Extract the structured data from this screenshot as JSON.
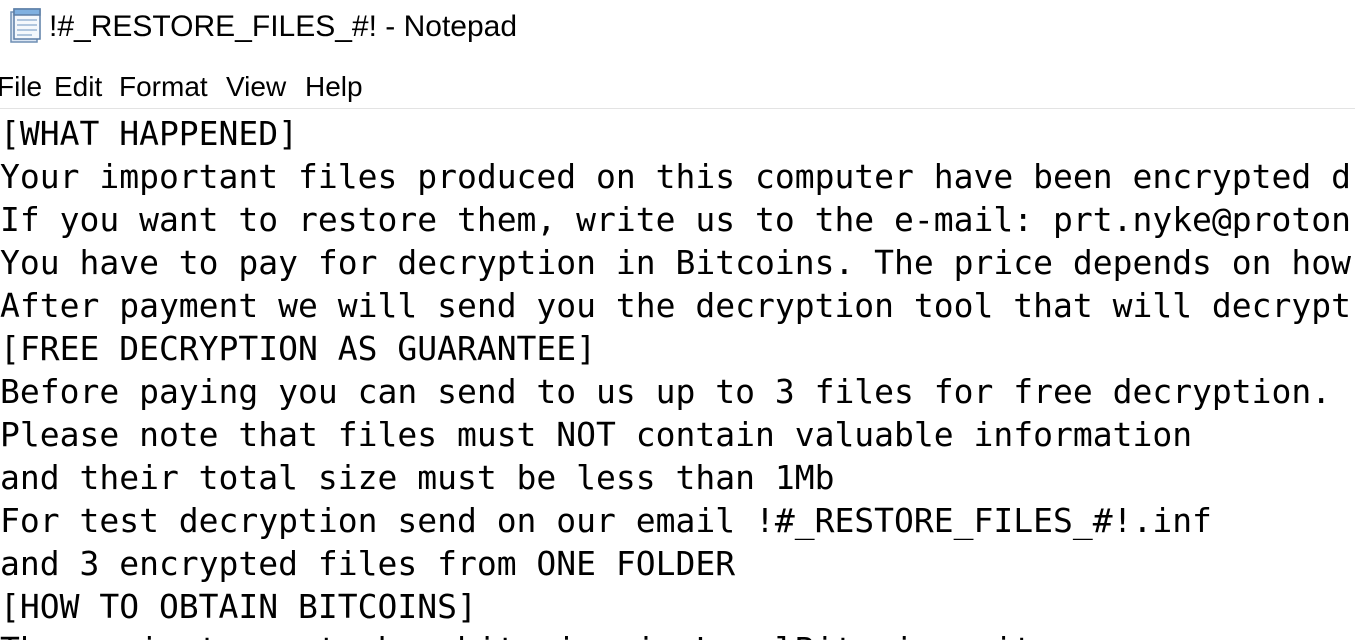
{
  "window": {
    "title": "!#_RESTORE_FILES_#! - Notepad",
    "icon": "notepad-icon"
  },
  "menu": {
    "items": [
      "File",
      "Edit",
      "Format",
      "View",
      "Help"
    ]
  },
  "document": {
    "lines": [
      "[WHAT HAPPENED]",
      "Your important files produced on this computer have been encrypted d",
      "If you want to restore them, write us to the e-mail: prt.nyke@proton",
      "You have to pay for decryption in Bitcoins. The price depends on how",
      "After payment we will send you the decryption tool that will decrypt",
      "[FREE DECRYPTION AS GUARANTEE]",
      "Before paying you can send to us up to 3 files for free decryption.",
      "Please note that files must NOT contain valuable information",
      "and their total size must be less than 1Mb",
      "For test decryption send on our email !#_RESTORE_FILES_#!.inf",
      "and 3 encrypted files from ONE FOLDER",
      "[HOW TO OBTAIN BITCOINS]",
      "The easiest way to buy bitcoins is LocalBitcoins site"
    ]
  }
}
